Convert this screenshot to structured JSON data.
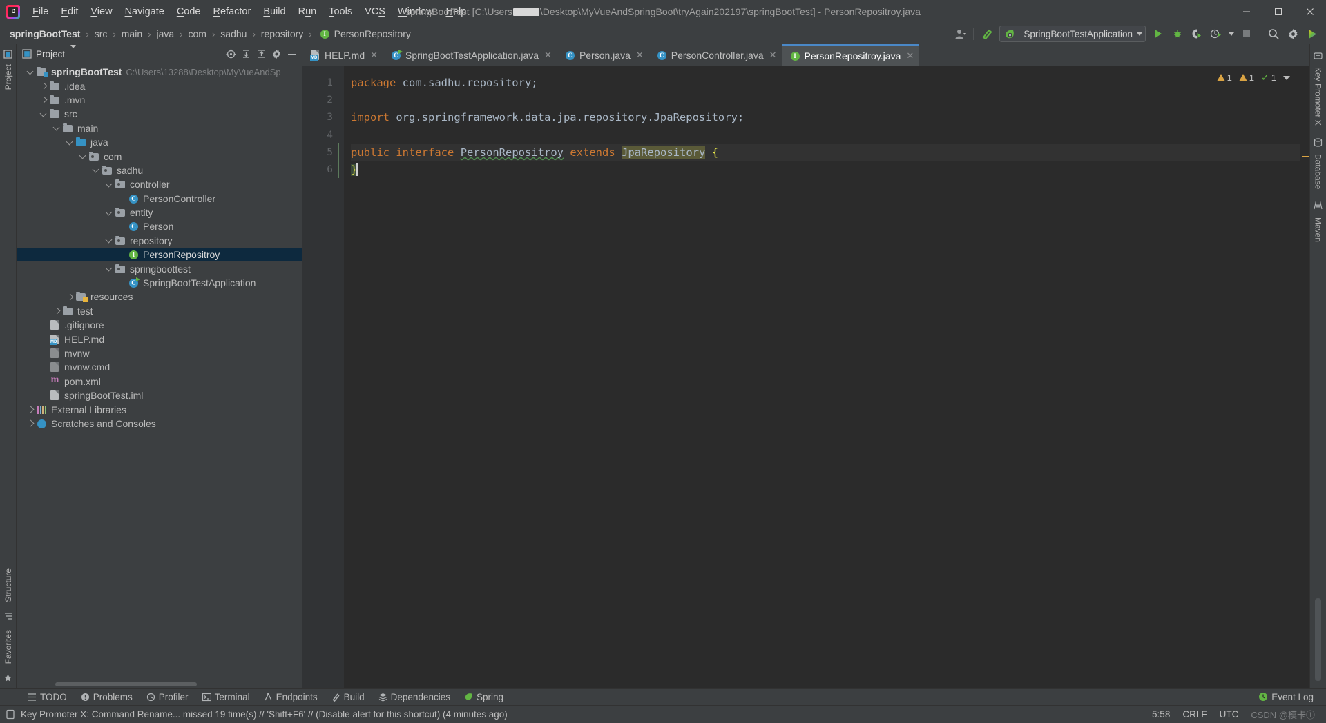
{
  "window": {
    "title_prefix": "springBootTest [C:\\Users",
    "title_suffix": "\\Desktop\\MyVueAndSpringBoot\\tryAgain202197\\springBootTest] - PersonRepositroy.java",
    "minimize": "─",
    "maximize": "☐",
    "close": "✕"
  },
  "menubar": {
    "items": [
      {
        "label": "File"
      },
      {
        "label": "Edit"
      },
      {
        "label": "View"
      },
      {
        "label": "Navigate"
      },
      {
        "label": "Code"
      },
      {
        "label": "Refactor"
      },
      {
        "label": "Build"
      },
      {
        "label": "Run"
      },
      {
        "label": "Tools"
      },
      {
        "label": "VCS"
      },
      {
        "label": "Window"
      },
      {
        "label": "Help"
      }
    ]
  },
  "breadcrumb": {
    "items": [
      "springBootTest",
      "src",
      "main",
      "java",
      "com",
      "sadhu",
      "repository",
      "PersonRepository"
    ],
    "separator": "›"
  },
  "toolbar": {
    "run_config": "SpringBootTestApplication",
    "icons": [
      "user-icon",
      "hammer-build-icon",
      "run-icon",
      "debug-icon",
      "run-coverage-icon",
      "profiler-icon",
      "stop-icon",
      "search-everywhere-icon",
      "settings-icon",
      "updates-icon"
    ]
  },
  "project_panel": {
    "title": "Project",
    "actions": [
      "locate-icon",
      "expand-all-icon",
      "collapse-all-icon",
      "settings-icon",
      "hide-icon"
    ],
    "tree": [
      {
        "depth": 0,
        "label": "springBootTest",
        "path": "C:\\Users\\13288\\Desktop\\MyVueAndSp",
        "icon": "module-folder",
        "arrow": "down",
        "bold": true
      },
      {
        "depth": 1,
        "label": ".idea",
        "icon": "folder",
        "arrow": "right"
      },
      {
        "depth": 1,
        "label": ".mvn",
        "icon": "folder",
        "arrow": "right"
      },
      {
        "depth": 1,
        "label": "src",
        "icon": "folder",
        "arrow": "down"
      },
      {
        "depth": 2,
        "label": "main",
        "icon": "folder",
        "arrow": "down"
      },
      {
        "depth": 3,
        "label": "java",
        "icon": "source-folder",
        "arrow": "down"
      },
      {
        "depth": 4,
        "label": "com",
        "icon": "package",
        "arrow": "down"
      },
      {
        "depth": 5,
        "label": "sadhu",
        "icon": "package",
        "arrow": "down"
      },
      {
        "depth": 6,
        "label": "controller",
        "icon": "package",
        "arrow": "down"
      },
      {
        "depth": 7,
        "label": "PersonController",
        "icon": "class"
      },
      {
        "depth": 6,
        "label": "entity",
        "icon": "package",
        "arrow": "down"
      },
      {
        "depth": 7,
        "label": "Person",
        "icon": "class"
      },
      {
        "depth": 6,
        "label": "repository",
        "icon": "package",
        "arrow": "down"
      },
      {
        "depth": 7,
        "label": "PersonRepositroy",
        "icon": "interface",
        "selected": true
      },
      {
        "depth": 6,
        "label": "springboottest",
        "icon": "package",
        "arrow": "down"
      },
      {
        "depth": 7,
        "label": "SpringBootTestApplication",
        "icon": "spring-class"
      },
      {
        "depth": 3,
        "label": "resources",
        "icon": "resource-folder",
        "arrow": "right"
      },
      {
        "depth": 2,
        "label": "test",
        "icon": "folder",
        "arrow": "right"
      },
      {
        "depth": 1,
        "label": ".gitignore",
        "icon": "gitignore-file"
      },
      {
        "depth": 1,
        "label": "HELP.md",
        "icon": "markdown-file"
      },
      {
        "depth": 1,
        "label": "mvnw",
        "icon": "script-file"
      },
      {
        "depth": 1,
        "label": "mvnw.cmd",
        "icon": "script-file"
      },
      {
        "depth": 1,
        "label": "pom.xml",
        "icon": "maven-file"
      },
      {
        "depth": 1,
        "label": "springBootTest.iml",
        "icon": "iml-file"
      },
      {
        "depth": 0,
        "label": "External Libraries",
        "icon": "libraries",
        "arrow": "right"
      },
      {
        "depth": 0,
        "label": "Scratches and Consoles",
        "icon": "scratches",
        "arrow": "right"
      }
    ]
  },
  "left_rail": {
    "items": [
      "Project",
      "Structure",
      "Favorites"
    ]
  },
  "right_rail": {
    "items": [
      "Key Promoter X",
      "Database",
      "Maven"
    ]
  },
  "editor_tabs": [
    {
      "label": "HELP.md",
      "icon": "markdown-file",
      "active": false
    },
    {
      "label": "SpringBootTestApplication.java",
      "icon": "spring-class",
      "active": false
    },
    {
      "label": "Person.java",
      "icon": "class",
      "active": false
    },
    {
      "label": "PersonController.java",
      "icon": "class",
      "active": false
    },
    {
      "label": "PersonRepositroy.java",
      "icon": "interface",
      "active": true
    }
  ],
  "editor": {
    "line_numbers": [
      "1",
      "2",
      "3",
      "4",
      "5",
      "6"
    ],
    "lines": [
      [
        {
          "t": "package",
          "c": "kw"
        },
        {
          "t": " com.sadhu.repository;",
          "c": "ident"
        }
      ],
      [],
      [
        {
          "t": "import",
          "c": "kw"
        },
        {
          "t": " org.springframework.data.jpa.repository.JpaRepository;",
          "c": "ident"
        }
      ],
      [],
      [
        {
          "t": "public",
          "c": "kw"
        },
        {
          "t": " ",
          "c": "ident"
        },
        {
          "t": "interface",
          "c": "kw"
        },
        {
          "t": " ",
          "c": "ident"
        },
        {
          "t": "PersonRepositroy",
          "c": "typo"
        },
        {
          "t": " ",
          "c": "ident"
        },
        {
          "t": "extends",
          "c": "kw"
        },
        {
          "t": " ",
          "c": "ident"
        },
        {
          "t": "JpaRepository",
          "c": "hl"
        },
        {
          "t": " ",
          "c": "ident"
        },
        {
          "t": "{",
          "c": "brace"
        }
      ],
      [
        {
          "t": "}",
          "c": "brace"
        }
      ]
    ],
    "inspections": {
      "warnings": "1",
      "weak_warnings": "1",
      "checks": "1"
    }
  },
  "tool_windows": [
    {
      "label": "TODO",
      "icon": "todo-icon"
    },
    {
      "label": "Problems",
      "icon": "problems-icon"
    },
    {
      "label": "Profiler",
      "icon": "profiler-icon"
    },
    {
      "label": "Terminal",
      "icon": "terminal-icon"
    },
    {
      "label": "Endpoints",
      "icon": "endpoints-icon"
    },
    {
      "label": "Build",
      "icon": "build-icon"
    },
    {
      "label": "Dependencies",
      "icon": "dependencies-icon"
    },
    {
      "label": "Spring",
      "icon": "spring-icon"
    }
  ],
  "event_log": {
    "label": "Event Log",
    "icon": "event-log-icon"
  },
  "statusbar": {
    "message": "Key Promoter X: Command Rename... missed 19 time(s) // 'Shift+F6' // (Disable alert for this shortcut) (4 minutes ago)",
    "caret_position": "5:58",
    "line_separator": "CRLF",
    "encoding": "UTC",
    "watermark": "CSDN @模卡①"
  }
}
